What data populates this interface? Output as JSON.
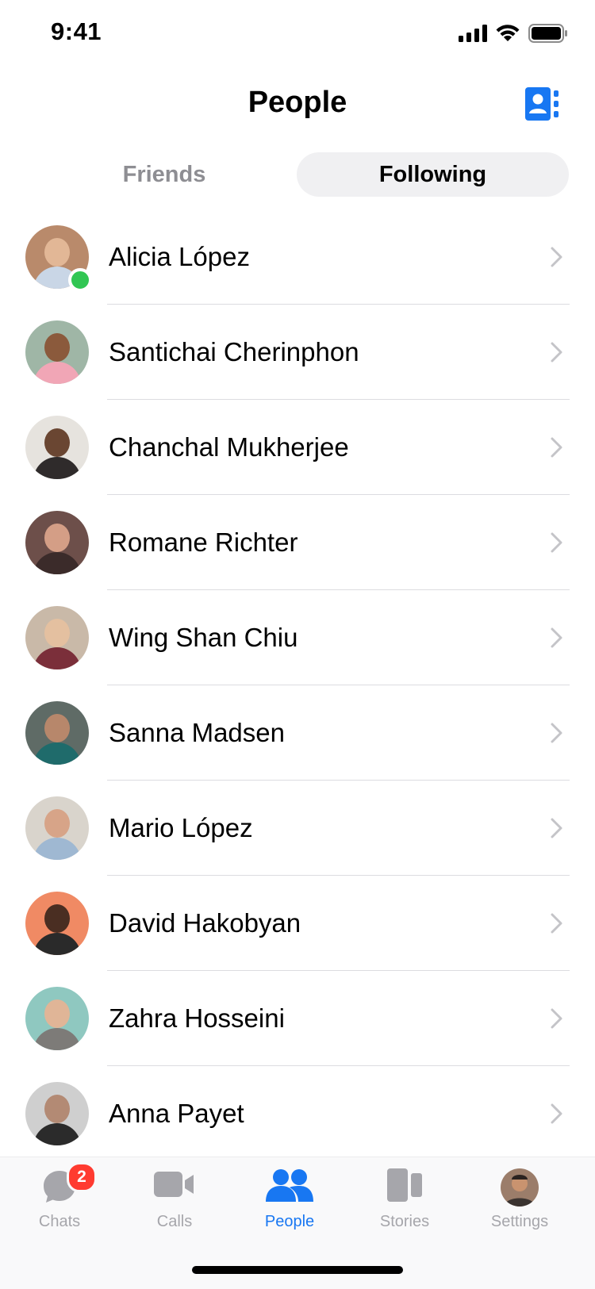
{
  "status": {
    "time": "9:41"
  },
  "header": {
    "title": "People"
  },
  "segments": {
    "friends": "Friends",
    "following": "Following"
  },
  "people": [
    {
      "name": "Alicia López",
      "online": true,
      "bg": "#b98a6b",
      "face": "#e2b796",
      "shirt": "#c9d6e6"
    },
    {
      "name": "Santichai Cherinphon",
      "online": false,
      "bg": "#9fb6a6",
      "face": "#8b5a3c",
      "shirt": "#f1a6b6"
    },
    {
      "name": "Chanchal Mukherjee",
      "online": false,
      "bg": "#e6e3de",
      "face": "#6a4632",
      "shirt": "#2f2b2b"
    },
    {
      "name": "Romane Richter",
      "online": false,
      "bg": "#6d4f4a",
      "face": "#d49e86",
      "shirt": "#3b2b2a"
    },
    {
      "name": "Wing Shan Chiu",
      "online": false,
      "bg": "#c9b9a8",
      "face": "#e4c0a0",
      "shirt": "#7b2f3a"
    },
    {
      "name": "Sanna Madsen",
      "online": false,
      "bg": "#5f6b66",
      "face": "#b7876b",
      "shirt": "#1f6b6b"
    },
    {
      "name": "Mario López",
      "online": false,
      "bg": "#d9d4cc",
      "face": "#d7a488",
      "shirt": "#9fb8d2"
    },
    {
      "name": "David Hakobyan",
      "online": false,
      "bg": "#f08a64",
      "face": "#4a2e22",
      "shirt": "#2a2a2a"
    },
    {
      "name": "Zahra Hosseini",
      "online": false,
      "bg": "#8fc8c0",
      "face": "#e0b597",
      "shirt": "#7d7b78"
    },
    {
      "name": "Anna Payet",
      "online": false,
      "bg": "#cfcfcf",
      "face": "#b38a74",
      "shirt": "#2b2b2b"
    }
  ],
  "tabs": [
    {
      "label": "Chats",
      "icon": "chat-bubble-icon",
      "badge": "2",
      "active": false
    },
    {
      "label": "Calls",
      "icon": "video-camera-icon",
      "active": false
    },
    {
      "label": "People",
      "icon": "people-icon",
      "active": true
    },
    {
      "label": "Stories",
      "icon": "stories-icon",
      "active": false
    },
    {
      "label": "Settings",
      "icon": "profile-avatar-icon",
      "active": false
    }
  ],
  "colors": {
    "accent": "#1877f2",
    "online": "#31c653",
    "badge": "#ff3b30",
    "inactive": "#a6a6ab"
  }
}
